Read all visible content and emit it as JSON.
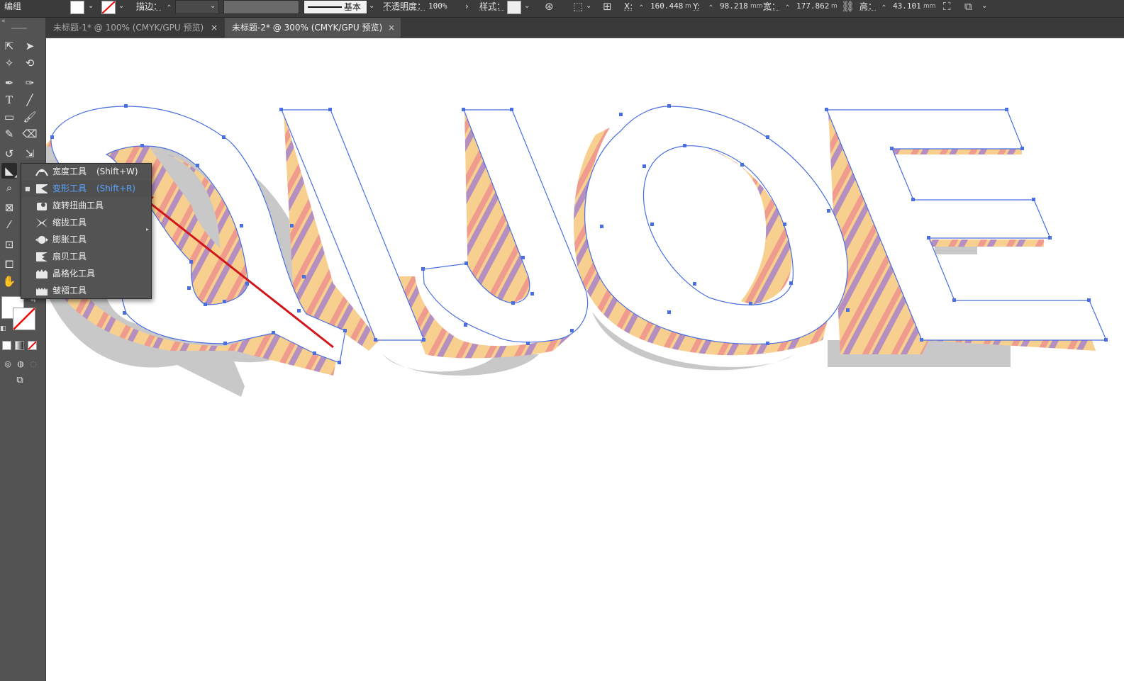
{
  "control_bar": {
    "selection_type": "编组",
    "stroke_label": "描边：",
    "stroke_profile": "基本",
    "opacity_label": "不透明度：",
    "opacity_value": "100%",
    "style_label": "样式：",
    "x_label": "X:",
    "x_value": "160.448",
    "x_unit": "m",
    "y_label": "Y:",
    "y_value": "98.218",
    "y_unit": "mm",
    "w_label": "宽：",
    "w_value": "177.862",
    "w_unit": "m",
    "h_label": "高：",
    "h_value": "43.101",
    "h_unit": "mm"
  },
  "tabs": [
    {
      "label": "未标题-1* @ 100% (CMYK/GPU 预览)",
      "close": "×",
      "active": false
    },
    {
      "label": "未标题-2* @ 300% (CMYK/GPU 预览)",
      "close": "×",
      "active": true
    }
  ],
  "flyout": {
    "items": [
      {
        "name": "宽度工具",
        "shortcut": "(Shift+W)",
        "icon": "width-tool-icon",
        "selected": false
      },
      {
        "name": "变形工具",
        "shortcut": "(Shift+R)",
        "icon": "warp-tool-icon",
        "selected": true
      },
      {
        "name": "旋转扭曲工具",
        "shortcut": "",
        "icon": "twirl-tool-icon",
        "selected": false
      },
      {
        "name": "缩拢工具",
        "shortcut": "",
        "icon": "pucker-tool-icon",
        "selected": false
      },
      {
        "name": "膨胀工具",
        "shortcut": "",
        "icon": "bloat-tool-icon",
        "selected": false
      },
      {
        "name": "扇贝工具",
        "shortcut": "",
        "icon": "scallop-tool-icon",
        "selected": false
      },
      {
        "name": "晶格化工具",
        "shortcut": "",
        "icon": "crystallize-tool-icon",
        "selected": false
      },
      {
        "name": "皱褶工具",
        "shortcut": "",
        "icon": "wrinkle-tool-icon",
        "selected": false
      }
    ],
    "selected_bullet": "■"
  },
  "colors": {
    "accent_blue": "#5aa3ff",
    "selection_path": "#4a6fe0",
    "arrow_red": "#d0161b",
    "stripe_yellow": "#f7d08f",
    "stripe_salmon": "#ef9b8e",
    "stripe_purple": "#b48fbf",
    "shadow_grey": "#c8c8c8"
  }
}
